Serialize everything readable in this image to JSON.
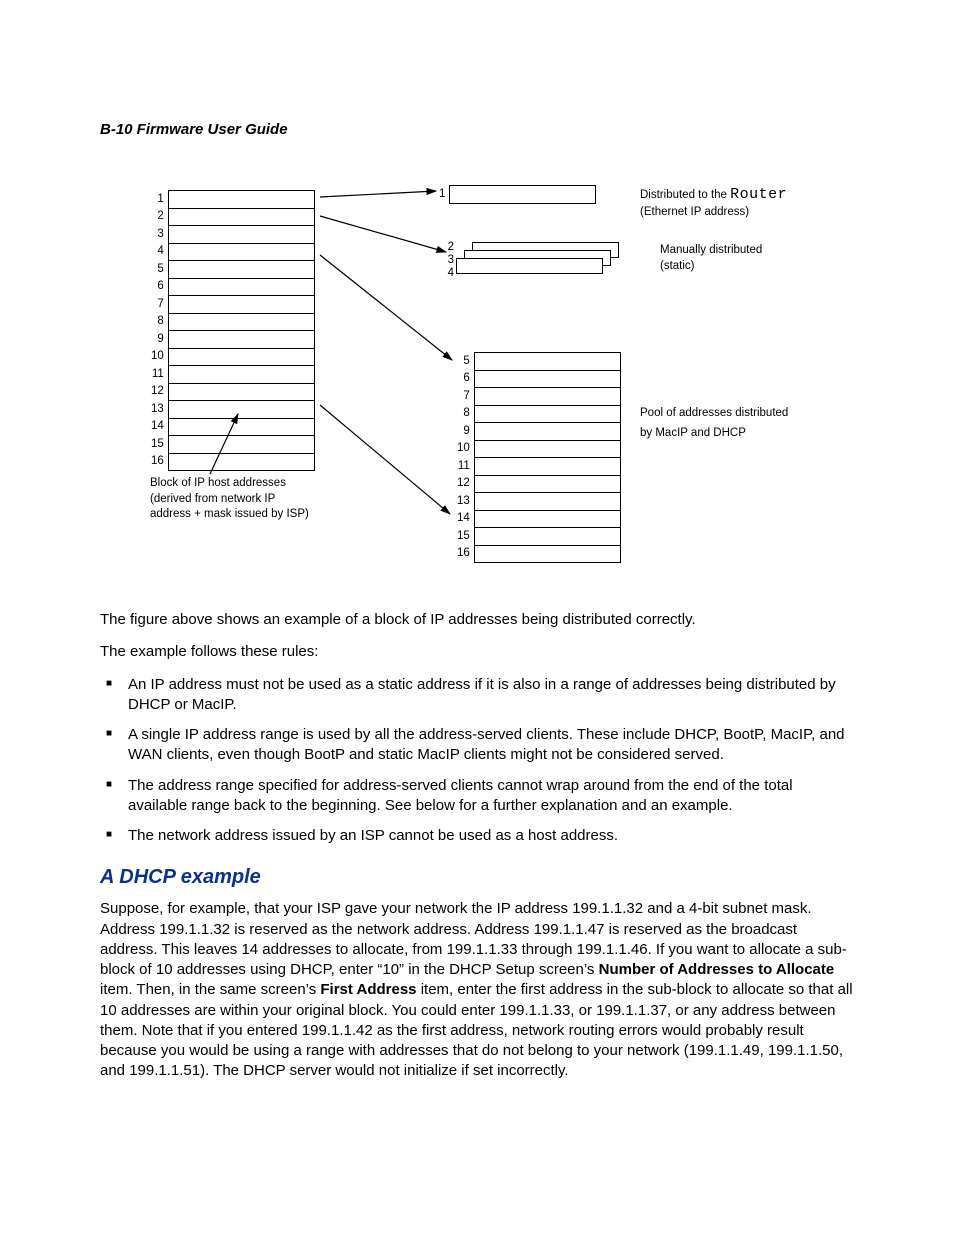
{
  "header": "B-10  Firmware User Guide",
  "figure": {
    "left_block_label": "Block of IP host addresses\n(derived from network IP\naddress + mask issued by ISP)",
    "router_line1": "Distributed to the ",
    "router_word": "Router",
    "router_line2": "(Ethernet IP address)",
    "static_label": "Manually distributed\n(static)",
    "pool_line1": "Pool of addresses distributed",
    "pool_line2": "by MacIP and DHCP"
  },
  "intro1": "The figure above shows an example of a block of IP addresses being distributed correctly.",
  "intro2": "The example follows these rules:",
  "rules": [
    "An IP address must not be used as a static address if it is also in a range of addresses being distributed by DHCP or MacIP.",
    "A single IP address range is used by all the address-served clients. These include DHCP, BootP, MacIP, and WAN clients, even though BootP and static MacIP clients might not be considered served.",
    "The address range specified for address-served clients cannot wrap around from the end of the total available range back to the beginning. See below for a further explanation and an example.",
    "The network address issued by an ISP cannot be used as a host address."
  ],
  "section_title": "A DHCP example",
  "dhcp": {
    "p1a": "Suppose, for example, that your ISP gave your network the IP address 199.1.1.32 and a 4-bit subnet mask. Address 199.1.1.32 is reserved as the network address. Address 199.1.1.47 is reserved as the broadcast address. This leaves 14 addresses to allocate, from 199.1.1.33 through 199.1.1.46. If you want to allocate a sub-block of 10 addresses using DHCP, enter “10” in the DHCP Setup screen’s ",
    "bold1": "Number of Addresses to Allocate",
    "p1b": " item. Then, in the same screen’s ",
    "bold2": "First Address",
    "p1c": " item, enter the first address in the sub-block to allocate so that all 10 addresses are within your original block. You could enter 199.1.1.33, or 199.1.1.37, or any address between them. Note that if you entered 199.1.1.42 as the first address, network routing errors would probably result because you would be using a range with addresses that do not belong to your network (199.1.1.49, 199.1.1.50, and 199.1.1.51). The DHCP server would not initialize if set incorrectly."
  }
}
